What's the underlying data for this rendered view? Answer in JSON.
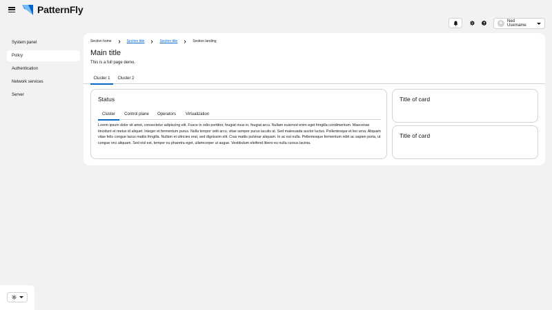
{
  "masthead": {
    "brand": "PatternFly",
    "user_name": "Ned Username"
  },
  "nav": {
    "items": [
      {
        "label": "System panel"
      },
      {
        "label": "Policy",
        "active": true
      },
      {
        "label": "Authentication"
      },
      {
        "label": "Network services"
      },
      {
        "label": "Server"
      }
    ]
  },
  "breadcrumb": {
    "home": "Section home",
    "title1": "Section title",
    "title2": "Section title",
    "landing": "Section landing"
  },
  "page": {
    "title": "Main title",
    "description": "This is a full page demo."
  },
  "tabs": [
    "Cluster 1",
    "Cluster 2"
  ],
  "status_card": {
    "title": "Status",
    "tabs": [
      "Cluster",
      "Control plane",
      "Operators",
      "Virtualization"
    ],
    "body": "Lorem ipsum dolor sit amet, consectetur adipiscing elit. Fusce in odio porttitor, feugiat risus in, feugiat arcu. Nullam euismod enim eget fringilla condimentum. Maecenas tincidunt et metus id aliquet. Integer et fermentum purus. Nulla tempor velit arcu, vitae semper purus iaculis at. Sed malesuada auctor luctus. Pellentesque et leo urna. Aliquam vitae felis congue lacus mattis fringilla. Nullam et ultricies erat, sed dignissim elit. Cras mattis pulvinar aliquam. In ac est nulla. Pellentesque fermentum nibh ac sapien porta, ut congue orci aliquam. Sed nisl est, tempor eu pharetra eget, ullamcorper ut augue. Vestibulum eleifend libero eu nulla cursus lacinia."
  },
  "cards": [
    {
      "title": "Title of card"
    },
    {
      "title": "Title of card"
    }
  ],
  "colors": {
    "accent": "#0066cc",
    "logo_blue": "#0066cc",
    "background": "#f2f2f2"
  }
}
